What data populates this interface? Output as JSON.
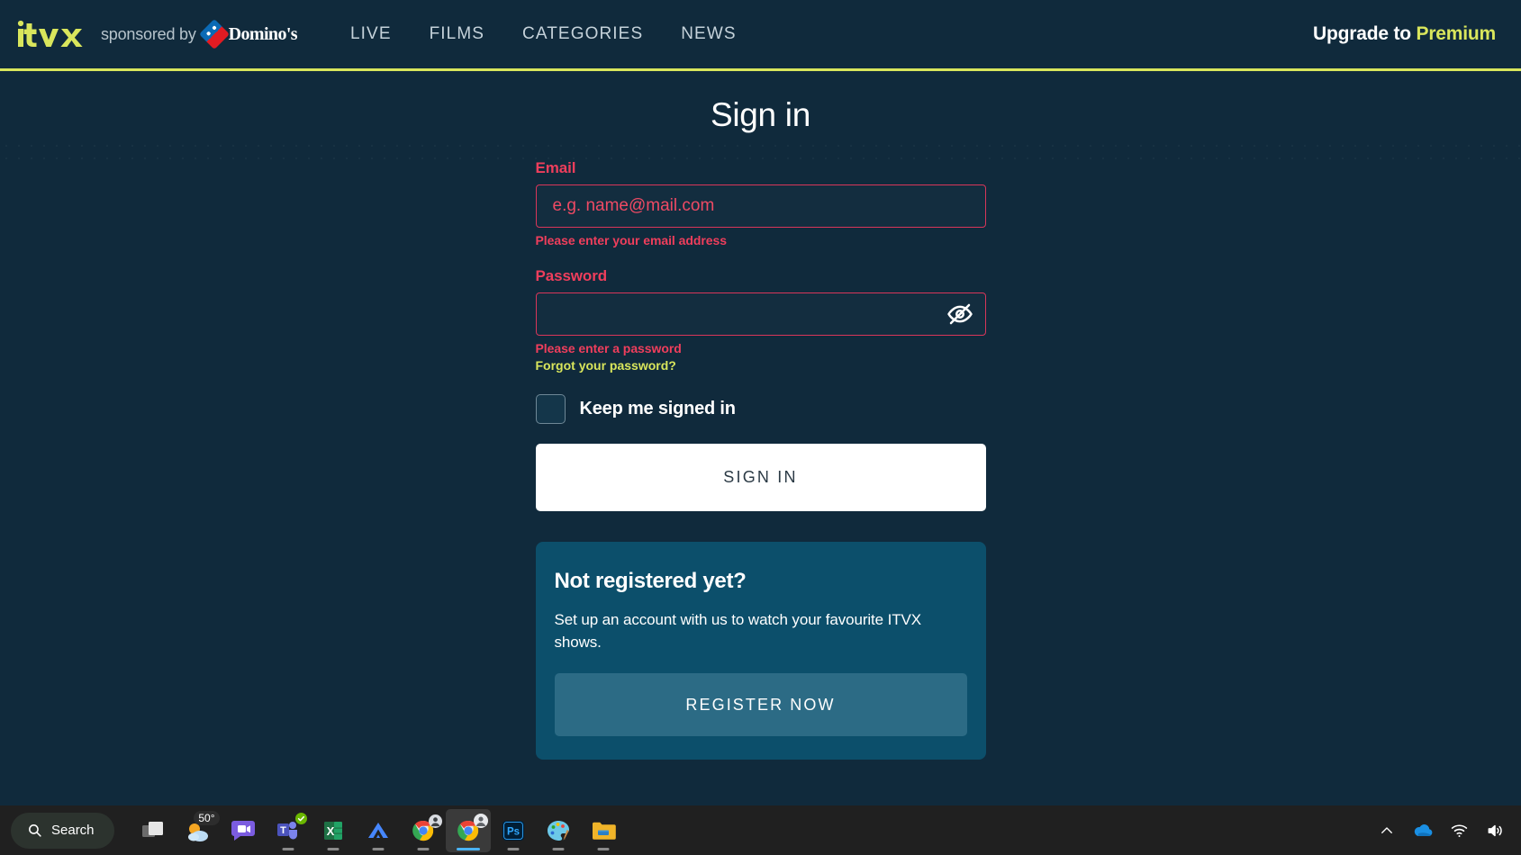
{
  "site": {
    "brand": "itvX",
    "sponsor_text": "sponsored by",
    "sponsor_brand": "Domino's",
    "nav": [
      {
        "label": "LIVE",
        "name": "nav-item-live"
      },
      {
        "label": "FILMS",
        "name": "nav-item-films"
      },
      {
        "label": "CATEGORIES",
        "name": "nav-item-categories"
      },
      {
        "label": "NEWS",
        "name": "nav-item-news"
      }
    ],
    "upgrade_prefix": "Upgrade to ",
    "upgrade_highlight": "Premium",
    "colors": {
      "page_bg": "#102a3c",
      "accent_lime": "#d9e65c",
      "error_red": "#ef3e5c",
      "card_bg": "#0c4f6b",
      "card_button": "#2c6b85"
    }
  },
  "signin": {
    "title": "Sign in",
    "email": {
      "label": "Email",
      "placeholder": "e.g. name@mail.com",
      "value": "",
      "error": "Please enter your email address"
    },
    "password": {
      "label": "Password",
      "placeholder": "",
      "value": "",
      "error": "Please enter a password",
      "forgot_label": "Forgot your password?",
      "toggle_icon": "eye-off-icon"
    },
    "keep_signed_in": {
      "label": "Keep me signed in",
      "checked": false
    },
    "submit_label": "SIGN IN"
  },
  "register_card": {
    "title": "Not registered yet?",
    "description": "Set up an account with us to watch your favourite ITVX shows.",
    "button_label": "REGISTER NOW"
  },
  "taskbar": {
    "search_label": "Search",
    "weather_temp": "50°",
    "apps": [
      {
        "name": "task-view",
        "icon": "task-view-icon"
      },
      {
        "name": "weather-widget",
        "icon": "weather-icon"
      },
      {
        "name": "teams-chat",
        "icon": "chat-video-icon"
      },
      {
        "name": "microsoft-teams",
        "icon": "teams-icon"
      },
      {
        "name": "microsoft-excel",
        "icon": "excel-icon"
      },
      {
        "name": "nordvpn",
        "icon": "nordvpn-icon"
      },
      {
        "name": "google-chrome",
        "icon": "chrome-icon"
      },
      {
        "name": "google-chrome-active",
        "icon": "chrome-icon"
      },
      {
        "name": "adobe-photoshop",
        "icon": "photoshop-icon"
      },
      {
        "name": "paint",
        "icon": "paint-palette-icon"
      },
      {
        "name": "file-explorer",
        "icon": "folder-icon"
      }
    ],
    "tray": [
      {
        "name": "show-hidden-icons",
        "icon": "chevron-up-icon"
      },
      {
        "name": "onedrive",
        "icon": "cloud-icon"
      },
      {
        "name": "network",
        "icon": "wifi-icon"
      },
      {
        "name": "volume",
        "icon": "speaker-icon"
      }
    ]
  }
}
